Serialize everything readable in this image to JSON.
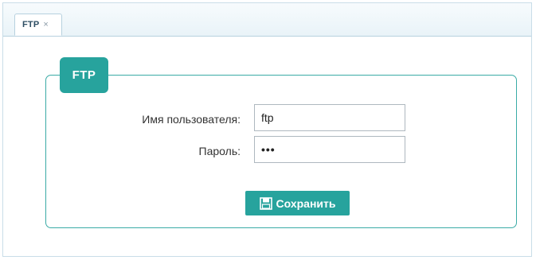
{
  "tabs": [
    {
      "label": "FTP",
      "close": "×"
    }
  ],
  "form": {
    "legend": "FTP",
    "username": {
      "label": "Имя пользователя:",
      "value": "ftp"
    },
    "password": {
      "label": "Пароль:",
      "value": "•••"
    }
  },
  "actions": {
    "save_label": "Сохранить",
    "save_icon": "floppy-disk-icon"
  },
  "colors": {
    "accent": "#27a39d",
    "tab_border": "#b7d1df"
  }
}
